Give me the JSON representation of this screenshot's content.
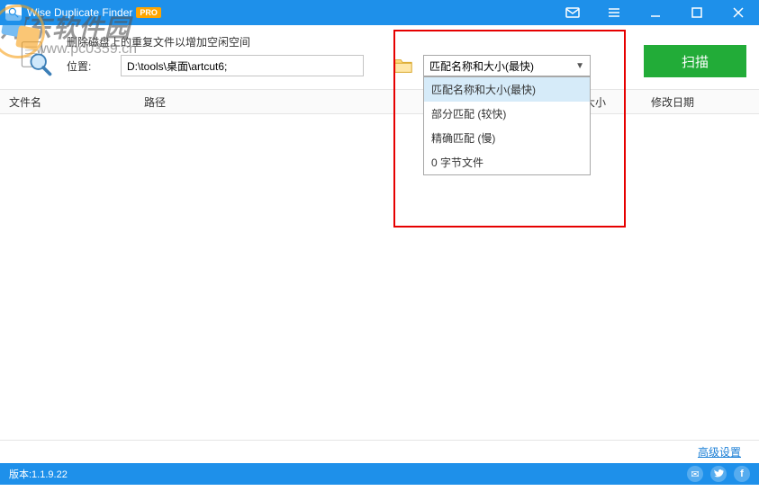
{
  "titlebar": {
    "app_name": "Wise Duplicate Finder",
    "pro": "PRO"
  },
  "watermark": {
    "text": "河东软件园",
    "url": "www.pc0359.cn"
  },
  "search": {
    "subtitle": "删除磁盘上的重复文件以增加空闲空间",
    "location_label": "位置:",
    "path_value": "D:\\tools\\桌面\\artcut6;",
    "scan_label": "扫描"
  },
  "dropdown": {
    "selected": "匹配名称和大小(最快)",
    "options": [
      "匹配名称和大小(最快)",
      "部分匹配 (较快)",
      "精确匹配 (慢)",
      "0 字节文件"
    ]
  },
  "columns": {
    "name": "文件名",
    "path": "路径",
    "size": "大小",
    "date": "修改日期"
  },
  "advanced_link": "高级设置",
  "status": {
    "version": "版本:1.1.9.22"
  }
}
